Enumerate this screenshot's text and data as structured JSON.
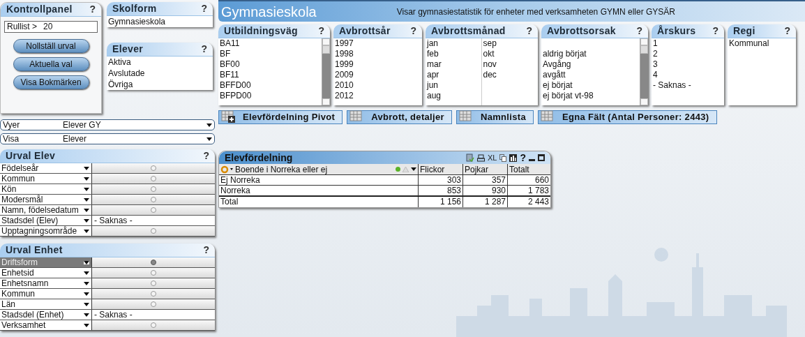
{
  "control_panel": {
    "title": "Kontrollpanel",
    "help": "?",
    "scroll_label": "Rullist >",
    "scroll_value": "20",
    "buttons": [
      "Nollställ urval",
      "Aktuella val",
      "Visa Bokmärken"
    ]
  },
  "skolform": {
    "title": "Skolform",
    "help": "?",
    "items": [
      "Gymnasieskola"
    ]
  },
  "elever": {
    "title": "Elever",
    "help": "?",
    "items": [
      "Aktiva",
      "Avslutade",
      "Övriga"
    ]
  },
  "dropdowns": [
    {
      "label": "Vyer",
      "value": "Elever GY"
    },
    {
      "label": "Visa",
      "value": "Elever"
    }
  ],
  "urval_panels": [
    {
      "title": "Urval Elev",
      "help": "?",
      "rows": [
        {
          "label": "Födelseår",
          "highlighted": false
        },
        {
          "label": "Kommun",
          "highlighted": false
        },
        {
          "label": "Kön",
          "highlighted": false
        },
        {
          "label": "Modersmål",
          "highlighted": false
        },
        {
          "label": "Namn, födelsedatum",
          "highlighted": false
        },
        {
          "label": "Stadsdel (Elev)",
          "highlighted": false,
          "value": "- Saknas -"
        },
        {
          "label": "Upptagningsområde",
          "highlighted": false
        }
      ]
    },
    {
      "title": "Urval Enhet",
      "help": "?",
      "rows": [
        {
          "label": "Driftsform",
          "highlighted": true
        },
        {
          "label": "Enhetsid",
          "highlighted": false
        },
        {
          "label": "Enhetsnamn",
          "highlighted": false
        },
        {
          "label": "Kommun",
          "highlighted": false
        },
        {
          "label": "Län",
          "highlighted": false
        },
        {
          "label": "Stadsdel (Enhet)",
          "highlighted": false,
          "value": "- Saknas -"
        },
        {
          "label": "Verksamhet",
          "highlighted": false
        }
      ]
    }
  ],
  "header": {
    "title": "Gymnasieskola",
    "description": "Visar gymnasiestatistik för enheter med verksamheten GYMN eller GYSÄR"
  },
  "listboxes": [
    {
      "title": "Utbildningsväg",
      "help": "?",
      "kind": "single",
      "scrollbar": true,
      "blank_first_row": false,
      "items": [
        "BA11",
        "BF",
        "BF00",
        "BF11",
        "BFFD00",
        "BFPD00"
      ]
    },
    {
      "title": "Avbrottsår",
      "help": "?",
      "kind": "single",
      "scrollbar": false,
      "blank_first_row": false,
      "items": [
        "1997",
        "1998",
        "1999",
        "2009",
        "2010",
        "2012"
      ]
    },
    {
      "title": "Avbrottsmånad",
      "help": "?",
      "kind": "two-column",
      "scrollbar": false,
      "blank_first_row": false,
      "items": [
        "jan",
        "feb",
        "mar",
        "apr",
        "jun",
        "aug",
        "sep",
        "okt",
        "nov",
        "dec"
      ]
    },
    {
      "title": "Avbrottsorsak",
      "help": "?",
      "kind": "single",
      "scrollbar": true,
      "blank_first_row": true,
      "items": [
        "aldrig börjat",
        "Avgång",
        "avgått",
        "ej börjat",
        "ej börjat vt-98"
      ]
    },
    {
      "title": "Årskurs",
      "help": "?",
      "kind": "single",
      "scrollbar": false,
      "blank_first_row": false,
      "items": [
        "1",
        "2",
        "3",
        "4",
        "- Saknas -"
      ]
    },
    {
      "title": "Regi",
      "help": "?",
      "kind": "single",
      "scrollbar": false,
      "blank_first_row": false,
      "items": [
        "Kommunal"
      ]
    }
  ],
  "tabs": [
    {
      "label": "Elevfördelning Pivot",
      "kind": "pivot"
    },
    {
      "label": "Avbrott, detaljer",
      "kind": "table"
    },
    {
      "label": "Namnlista",
      "kind": "table"
    },
    {
      "label": "Egna Fält (Antal Personer: 2443)",
      "kind": "table"
    }
  ],
  "pivot": {
    "title": "Elevfördelning",
    "xl": "XL",
    "help": "?",
    "dimension": "Boende i Norreka eller ej",
    "columns": [
      "Flickor",
      "Pojkar",
      "Totalt"
    ],
    "rows": [
      {
        "label": "Ej Norreka",
        "values": [
          "303",
          "357",
          "660"
        ]
      },
      {
        "label": "Norreka",
        "values": [
          "853",
          "930",
          "1 783"
        ]
      }
    ],
    "total": {
      "label": "Total",
      "values": [
        "1 156",
        "1 287",
        "2 443"
      ]
    }
  }
}
